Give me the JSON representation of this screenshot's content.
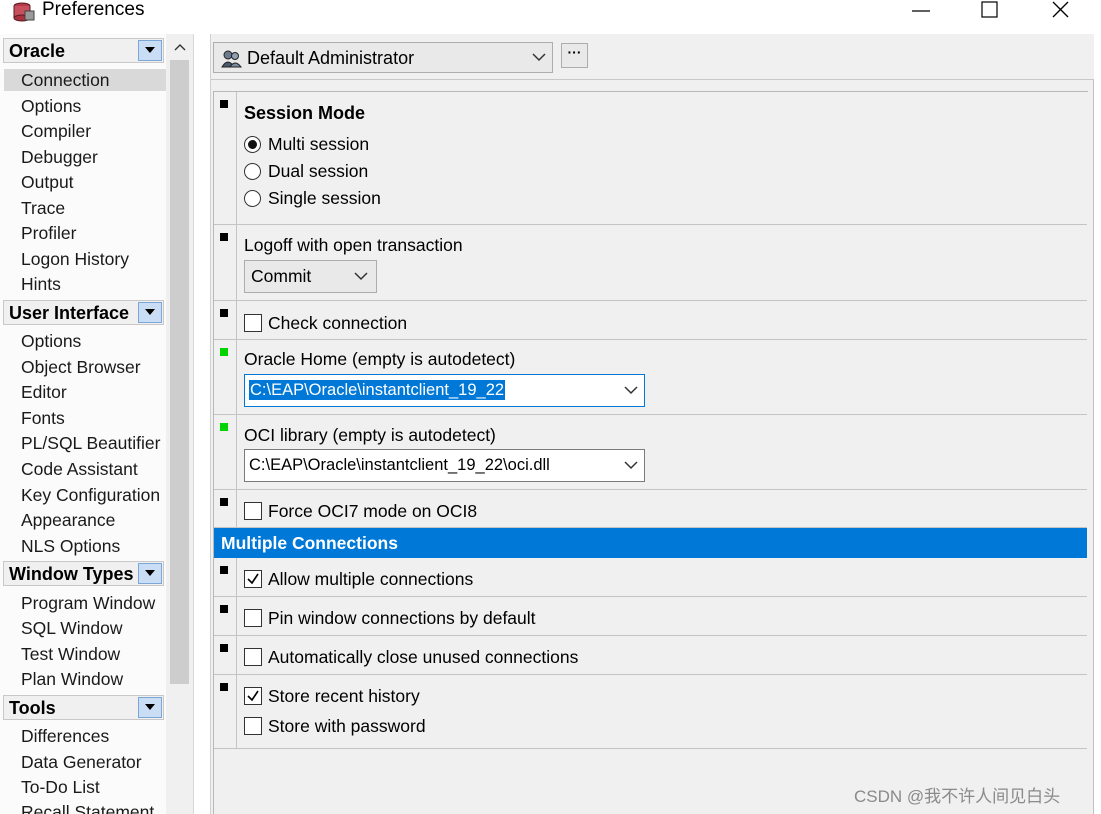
{
  "window": {
    "title": "Preferences"
  },
  "nav": {
    "categories": [
      {
        "label": "Oracle",
        "items": [
          "Connection",
          "Options",
          "Compiler",
          "Debugger",
          "Output",
          "Trace",
          "Profiler",
          "Logon History",
          "Hints"
        ]
      },
      {
        "label": "User Interface",
        "items": [
          "Options",
          "Object Browser",
          "Editor",
          "Fonts",
          "PL/SQL Beautifier",
          "Code Assistant",
          "Key Configuration",
          "Appearance",
          "NLS Options"
        ]
      },
      {
        "label": "Window Types",
        "items": [
          "Program Window",
          "SQL Window",
          "Test Window",
          "Plan Window"
        ]
      },
      {
        "label": "Tools",
        "items": [
          "Differences",
          "Data Generator",
          "To-Do List",
          "Recall Statement"
        ]
      }
    ],
    "selected": "Connection"
  },
  "profile": {
    "label": "Default Administrator",
    "more_label": "···"
  },
  "session_mode": {
    "heading": "Session Mode",
    "options": [
      {
        "label": "Multi session",
        "checked": true
      },
      {
        "label": "Dual session",
        "checked": false
      },
      {
        "label": "Single session",
        "checked": false
      }
    ]
  },
  "logoff": {
    "label": "Logoff with open transaction",
    "value": "Commit"
  },
  "check_connection": {
    "label": "Check connection",
    "checked": false
  },
  "oracle_home": {
    "label": "Oracle Home (empty is autodetect)",
    "value": "C:\\EAP\\Oracle\\instantclient_19_22"
  },
  "oci_library": {
    "label": "OCI library (empty is autodetect)",
    "value": "C:\\EAP\\Oracle\\instantclient_19_22\\oci.dll"
  },
  "force_oci7": {
    "label": "Force OCI7 mode on OCI8",
    "checked": false
  },
  "multiple_connections": {
    "heading": "Multiple Connections",
    "allow": {
      "label": "Allow multiple connections",
      "checked": true
    },
    "pin": {
      "label": "Pin window connections by default",
      "checked": false
    },
    "auto_close": {
      "label": "Automatically close unused connections",
      "checked": false
    },
    "store_history": {
      "label": "Store recent history",
      "checked": true
    },
    "store_password": {
      "label": "Store with password",
      "checked": false
    }
  },
  "watermark": "CSDN @我不许人间见白头",
  "colors": {
    "accent": "#0078d7",
    "marker_default": "#000000",
    "marker_modified": "#00d400"
  }
}
